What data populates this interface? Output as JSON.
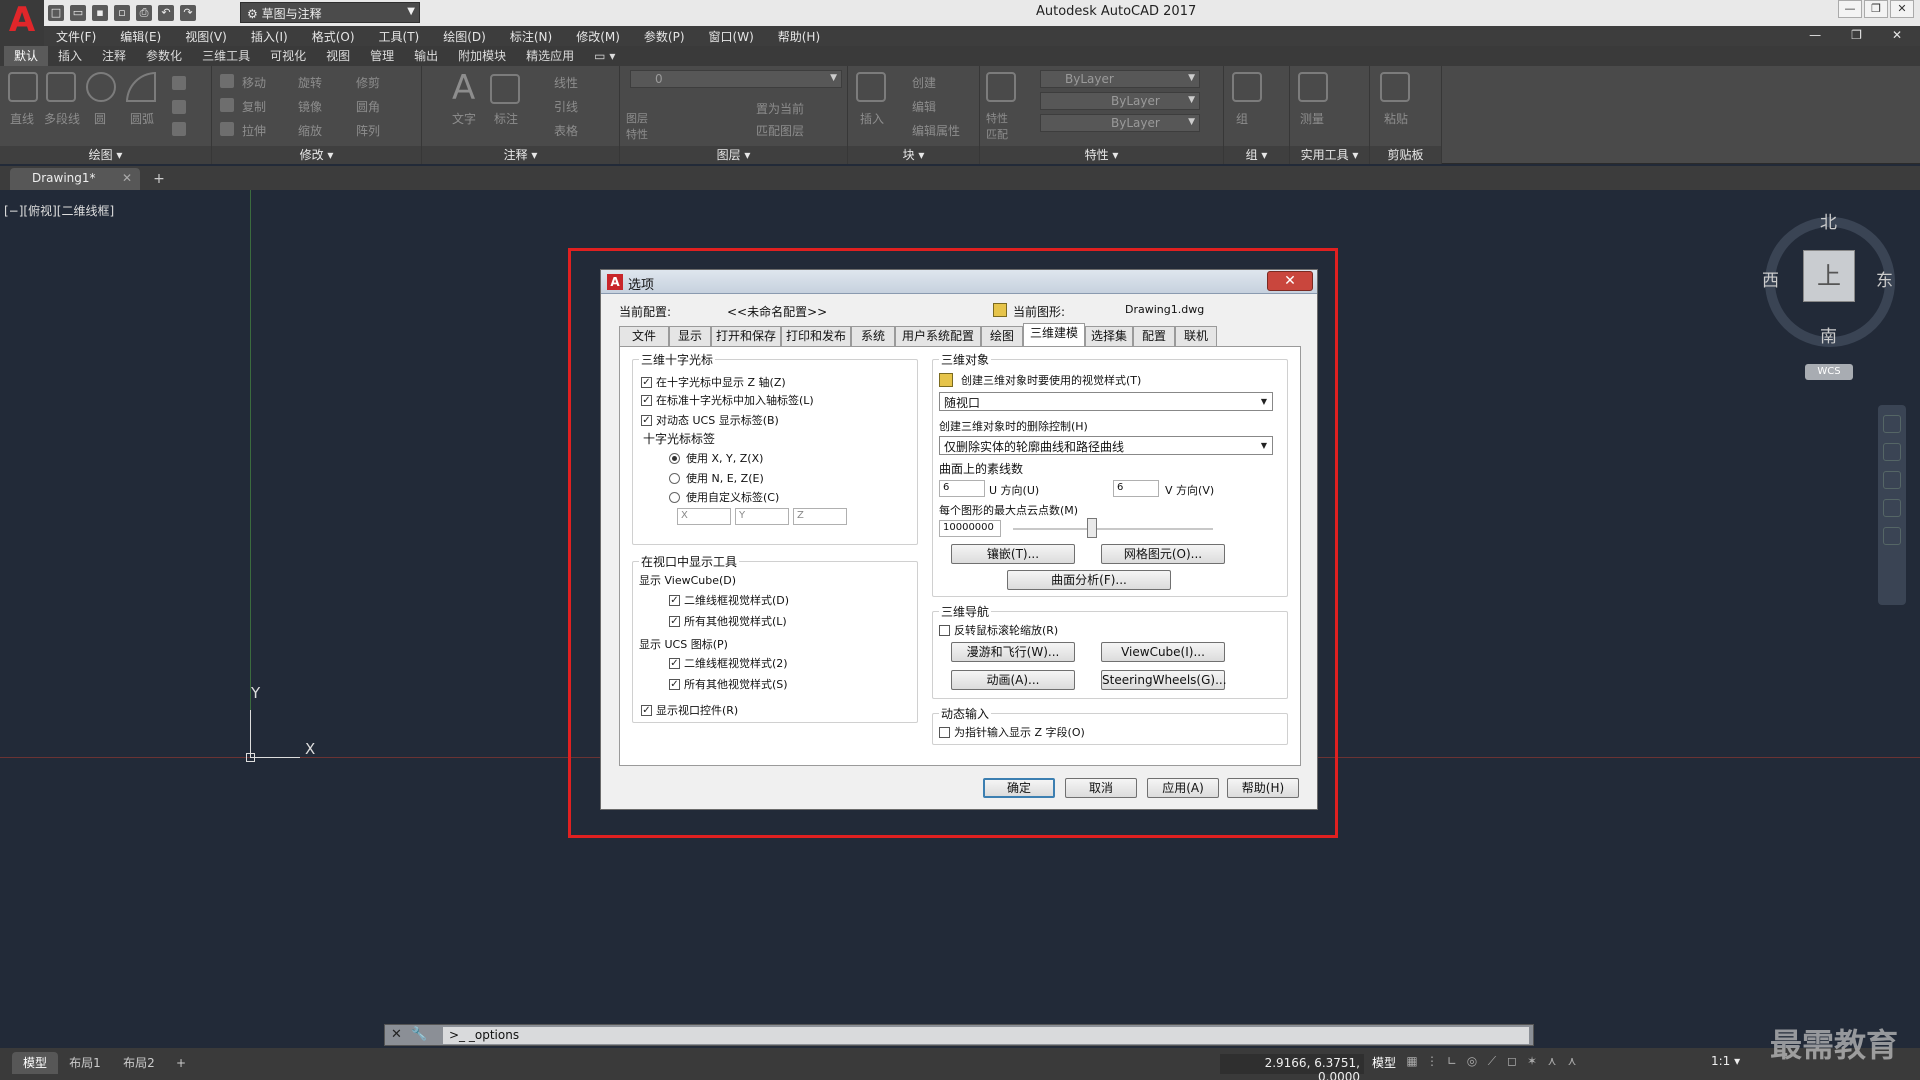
{
  "app": {
    "title": "Autodesk AutoCAD 2017",
    "logo": "A",
    "workspace": "草图与注释",
    "window_buttons": [
      "—",
      "❐",
      "✕"
    ]
  },
  "menubar": {
    "items": [
      "文件(F)",
      "编辑(E)",
      "视图(V)",
      "插入(I)",
      "格式(O)",
      "工具(T)",
      "绘图(D)",
      "标注(N)",
      "修改(M)",
      "参数(P)",
      "窗口(W)",
      "帮助(H)"
    ]
  },
  "ribbon": {
    "tabs": [
      "默认",
      "插入",
      "注释",
      "参数化",
      "三维工具",
      "可视化",
      "视图",
      "管理",
      "输出",
      "附加模块",
      "精选应用"
    ],
    "panels": [
      {
        "title": "绘图 ▾",
        "labels": [
          "直线",
          "多段线",
          "圆",
          "圆弧"
        ]
      },
      {
        "title": "修改 ▾",
        "labels": [
          "移动",
          "旋转",
          "修剪",
          "复制",
          "镜像",
          "圆角",
          "拉伸",
          "缩放",
          "阵列"
        ]
      },
      {
        "title": "注释 ▾",
        "labels": [
          "文字",
          "标注",
          "线性",
          "引线",
          "表格"
        ]
      },
      {
        "title": "图层 ▾",
        "labels": [
          "图层特性",
          "置为当前",
          "匹配图层"
        ],
        "layer_value": "0"
      },
      {
        "title": "块 ▾",
        "labels": [
          "插入",
          "创建",
          "编辑",
          "编辑属性"
        ]
      },
      {
        "title": "特性 ▾",
        "labels": [
          "特性匹配"
        ],
        "props": [
          "ByLayer",
          "ByLayer",
          "ByLayer"
        ]
      },
      {
        "title": "组 ▾",
        "labels": [
          "组"
        ]
      },
      {
        "title": "实用工具 ▾",
        "labels": [
          "测量"
        ]
      },
      {
        "title": "剪贴板",
        "labels": [
          "粘贴"
        ]
      }
    ]
  },
  "doc_tabs": {
    "active": "Drawing1*",
    "close": "✕",
    "new": "+"
  },
  "viewport": {
    "label": "[−][俯视][二维线框]",
    "ucs": {
      "y": "Y",
      "x": "X"
    },
    "viewcube": {
      "n": "北",
      "s": "南",
      "w": "西",
      "e": "东",
      "top": "上",
      "wcs": "WCS"
    }
  },
  "dialog": {
    "title": "选项",
    "close": "✕",
    "current_profile_label": "当前配置:",
    "current_profile_value": "<<未命名配置>>",
    "current_drawing_label": "当前图形:",
    "current_drawing_value": "Drawing1.dwg",
    "tabs": [
      "文件",
      "显示",
      "打开和保存",
      "打印和发布",
      "系统",
      "用户系统配置",
      "绘图",
      "三维建模",
      "选择集",
      "配置",
      "联机"
    ],
    "crosshair": {
      "title": "三维十字光标",
      "items": [
        "在十字光标中显示 Z 轴(Z)",
        "在标准十字光标中加入轴标签(L)",
        "对动态 UCS 显示标签(B)"
      ],
      "label_title": "十字光标标签",
      "radios": [
        "使用 X, Y, Z(X)",
        "使用 N, E, Z(E)",
        "使用自定义标签(C)"
      ],
      "fields": [
        "X",
        "Y",
        "Z"
      ]
    },
    "viewport_tools": {
      "title": "在视口中显示工具",
      "viewcube_label": "显示 ViewCube(D)",
      "viewcube_items": [
        "二维线框视觉样式(D)",
        "所有其他视觉样式(L)"
      ],
      "ucs_label": "显示 UCS 图标(P)",
      "ucs_items": [
        "二维线框视觉样式(2)",
        "所有其他视觉样式(S)"
      ],
      "controls": "显示视口控件(R)"
    },
    "objects": {
      "title": "三维对象",
      "style_label": "创建三维对象时要使用的视觉样式(T)",
      "style_value": "随视口",
      "delete_label": "创建三维对象时的删除控制(H)",
      "delete_value": "仅删除实体的轮廓曲线和路径曲线",
      "isolines_label": "曲面上的素线数",
      "u_value": "6",
      "u_label": "U 方向(U)",
      "v_value": "6",
      "v_label": "V 方向(V)",
      "points_label": "每个图形的最大点云点数(M)",
      "points_value": "10000000",
      "slider_fraction": 0.33,
      "btn_tessellation": "镶嵌(T)...",
      "btn_mesh": "网格图元(O)...",
      "btn_surface": "曲面分析(F)..."
    },
    "navigation": {
      "title": "三维导航",
      "reverse": "反转鼠标滚轮缩放(R)",
      "btn_walk": "漫游和飞行(W)...",
      "btn_viewcube": "ViewCube(I)...",
      "btn_anim": "动画(A)...",
      "btn_steering": "SteeringWheels(G)..."
    },
    "dynamic_input": {
      "title": "动态输入",
      "item": "为指针输入显示 Z 字段(O)"
    },
    "footer": {
      "ok": "确定",
      "cancel": "取消",
      "apply": "应用(A)",
      "help": "帮助(H)"
    }
  },
  "command_line": {
    "close": "✕",
    "wrench": "🔧",
    "text": "_options"
  },
  "statusbar": {
    "tabs": [
      "模型",
      "布局1",
      "布局2",
      "+"
    ],
    "coords": "2.9166, 6.3751, 0.0000",
    "model": "模型",
    "scale": "1:1 ▾"
  },
  "watermark": "最需教育"
}
